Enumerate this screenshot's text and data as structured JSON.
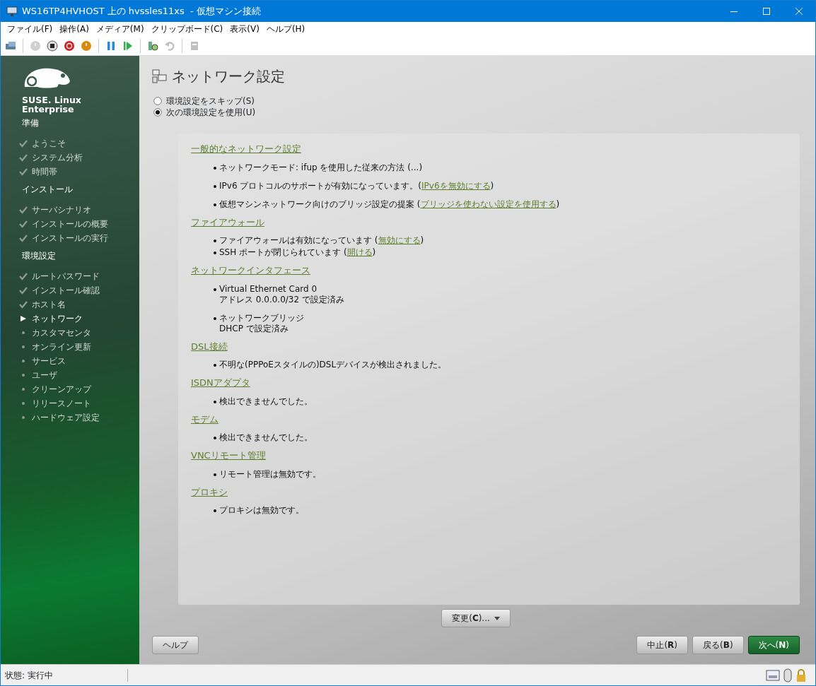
{
  "window": {
    "title": "WS16TP4HVHOST 上の hvssles11xs  - 仮想マシン接続"
  },
  "menu": [
    "ファイル(F)",
    "操作(A)",
    "メディア(M)",
    "クリップボード(C)",
    "表示(V)",
    "ヘルプ(H)"
  ],
  "toolbar": [
    {
      "kind": "ctrl-alt-del",
      "disabled": false
    },
    {
      "kind": "sep"
    },
    {
      "kind": "start",
      "disabled": true
    },
    {
      "kind": "stop",
      "disabled": false
    },
    {
      "kind": "shutdown",
      "disabled": false
    },
    {
      "kind": "power",
      "disabled": false
    },
    {
      "kind": "sep"
    },
    {
      "kind": "pause",
      "disabled": false
    },
    {
      "kind": "resume",
      "disabled": false
    },
    {
      "kind": "sep"
    },
    {
      "kind": "checkpoint",
      "disabled": false
    },
    {
      "kind": "revert",
      "disabled": true
    },
    {
      "kind": "sep"
    },
    {
      "kind": "session",
      "disabled": true
    }
  ],
  "brand": {
    "line1": "SUSE. Linux",
    "line2": "Enterprise"
  },
  "sidebar": [
    {
      "heading": "準備",
      "steps": [
        {
          "label": "ようこそ",
          "done": true,
          "current": false
        },
        {
          "label": "システム分析",
          "done": true,
          "current": false
        },
        {
          "label": "時間帯",
          "done": true,
          "current": false
        }
      ]
    },
    {
      "heading": "インストール",
      "steps": [
        {
          "label": "サーバシナリオ",
          "done": true,
          "current": false
        },
        {
          "label": "インストールの概要",
          "done": true,
          "current": false
        },
        {
          "label": "インストールの実行",
          "done": true,
          "current": false
        }
      ]
    },
    {
      "heading": "環境設定",
      "steps": [
        {
          "label": "ルートパスワード",
          "done": true,
          "current": false
        },
        {
          "label": "インストール確認",
          "done": true,
          "current": false
        },
        {
          "label": "ホスト名",
          "done": true,
          "current": false
        },
        {
          "label": "ネットワーク",
          "done": false,
          "current": true
        },
        {
          "label": "カスタマセンタ",
          "done": false,
          "current": false
        },
        {
          "label": "オンライン更新",
          "done": false,
          "current": false
        },
        {
          "label": "サービス",
          "done": false,
          "current": false
        },
        {
          "label": "ユーザ",
          "done": false,
          "current": false
        },
        {
          "label": "クリーンアップ",
          "done": false,
          "current": false
        },
        {
          "label": "リリースノート",
          "done": false,
          "current": false
        },
        {
          "label": "ハードウェア設定",
          "done": false,
          "current": false
        }
      ]
    }
  ],
  "page_title": "ネットワーク設定",
  "options": [
    {
      "label": "環境設定をスキップ(S)",
      "selected": false
    },
    {
      "label": "次の環境設定を使用(U)",
      "selected": true
    }
  ],
  "sections": [
    {
      "title": "一般的なネットワーク設定",
      "kind": "spaced",
      "items": [
        {
          "text": "ネットワークモード: ifup を使用した従来の方法 (...)"
        },
        {
          "text": "IPv6 プロトコルのサポートが有効になっています。(",
          "link": "IPv6を無効にする",
          "tail": ")"
        },
        {
          "text": "仮想マシンネットワーク向けのブリッジ設定の提案 (",
          "link": "ブリッジを使わない設定を使用する",
          "tail": ")"
        }
      ]
    },
    {
      "title": "ファイアウォール",
      "kind": "compact",
      "items": [
        {
          "text": "ファイアウォールは有効になっています (",
          "link": "無効にする",
          "tail": ")"
        },
        {
          "text": "SSH ポートが閉じられています (",
          "link": "開ける",
          "tail": ")"
        }
      ]
    },
    {
      "title": "ネットワークインタフェース",
      "kind": "spaced",
      "items": [
        {
          "text": "Virtual Ethernet Card 0",
          "detail": "アドレス 0.0.0.0/32 で設定済み"
        },
        {
          "text": "ネットワークブリッジ",
          "detail": "DHCP で設定済み"
        }
      ]
    },
    {
      "title": "DSL接続",
      "kind": "spaced",
      "items": [
        {
          "text": "不明な(PPPoEスタイルの)DSLデバイスが検出されました。"
        }
      ]
    },
    {
      "title": "ISDNアダプタ",
      "kind": "spaced",
      "items": [
        {
          "text": "検出できませんでした。"
        }
      ]
    },
    {
      "title": "モデム",
      "kind": "spaced",
      "items": [
        {
          "text": "検出できませんでした。"
        }
      ]
    },
    {
      "title": "VNCリモート管理",
      "kind": "spaced",
      "items": [
        {
          "text": "リモート管理は無効です。"
        }
      ]
    },
    {
      "title": "プロキシ",
      "kind": "spaced",
      "items": [
        {
          "text": "プロキシは無効です。"
        }
      ]
    }
  ],
  "change_button": "変更(**C**)...",
  "buttons": {
    "help": "ヘルプ",
    "abort": "中止(**R**)",
    "back": "戻る(**B**)",
    "next": "次へ(**N**)"
  },
  "status_bar": {
    "text": "状態: 実行中"
  }
}
